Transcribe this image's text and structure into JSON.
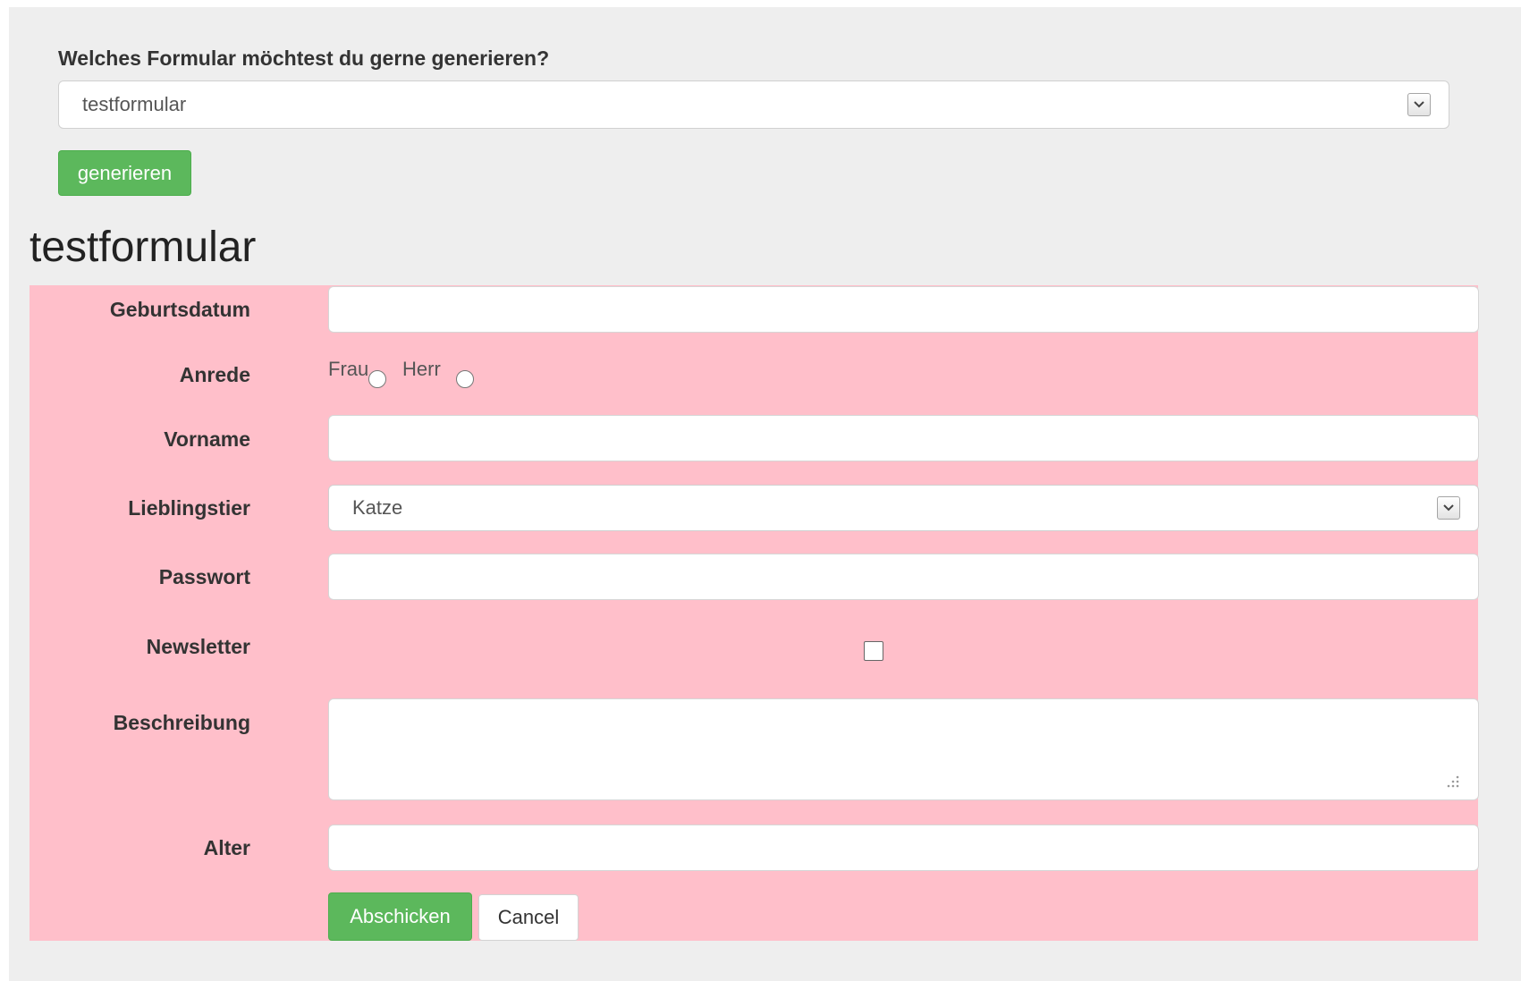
{
  "form_selector": {
    "question": "Welches Formular möchtest du gerne generieren?",
    "selected": "testformular",
    "generate_label": "generieren"
  },
  "form": {
    "title": "testformular",
    "fields": {
      "birthdate_label": "Geburtsdatum",
      "salutation_label": "Anrede",
      "salutation_options": [
        "Frau",
        "Herr"
      ],
      "firstname_label": "Vorname",
      "favorite_animal_label": "Lieblingstier",
      "favorite_animal_value": "Katze",
      "password_label": "Passwort",
      "newsletter_label": "Newsletter",
      "newsletter_checked": false,
      "description_label": "Beschreibung",
      "age_label": "Alter"
    },
    "submit_label": "Abschicken",
    "cancel_label": "Cancel"
  },
  "colors": {
    "page_bg": "#eeeeee",
    "form_bg": "#ffbfca",
    "primary_button": "#5cb85c"
  }
}
